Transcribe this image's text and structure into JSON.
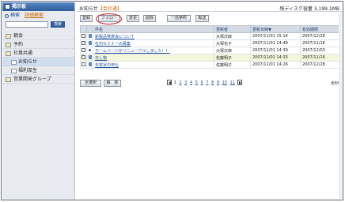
{
  "sidebar": {
    "title": "掲示板",
    "search_label": "検索",
    "advanced_search": "詳細検索",
    "search_button": "検索",
    "items": [
      {
        "label": "朝会"
      },
      {
        "label": "予約"
      },
      {
        "label": "社員共通"
      },
      {
        "label": "お知らせ"
      },
      {
        "label": "福利厚生"
      },
      {
        "label": "営業開発グループ"
      }
    ]
  },
  "main": {
    "title": "お知らせ",
    "title_flag": "【会社通】",
    "disk_info": "残ディスク容量 3,199.1MB"
  },
  "toolbar": {
    "register": "登録",
    "follow": "フォロー",
    "change": "変更",
    "delete": "削除",
    "bulk_ref": "一括参照",
    "transfer": "転送"
  },
  "table": {
    "headers": [
      "件名",
      "更新者",
      "更新日時▼",
      "有効期限"
    ],
    "rows": [
      {
        "subject": "新製品発表会について",
        "author": "大塚次郎",
        "updated": "2007/11/01 15:14",
        "expires": "2007/12/28"
      },
      {
        "subject": "社内セミナーの募集",
        "author": "大塚花子",
        "updated": "2007/11/01 14:48",
        "expires": "2007/11/16"
      },
      {
        "subject": "ホームページがリニューアルしました！！",
        "author": "大塚次郎",
        "updated": "2007/11/01 14:39",
        "expires": "2007/12/03"
      },
      {
        "subject": "忘し物",
        "author": "佐藤明子",
        "updated": "2007/11/01 14:33",
        "expires": "2007/11/16"
      },
      {
        "subject": "年賀状の申込",
        "author": "佐藤明子",
        "updated": "2007/11/01 14:26",
        "expires": "2007/12/28"
      }
    ]
  },
  "footer": {
    "select_all": "全選択",
    "clear": "解　除",
    "pages": [
      "1",
      "2",
      "3",
      "4",
      "5",
      "6",
      "7",
      "8",
      "9",
      "10",
      "11"
    ],
    "current_page": "1",
    "total": "全6件"
  },
  "colors": {
    "accent": "#2f5c9c",
    "link": "#1d4f9a",
    "highlight": "#d01818"
  }
}
